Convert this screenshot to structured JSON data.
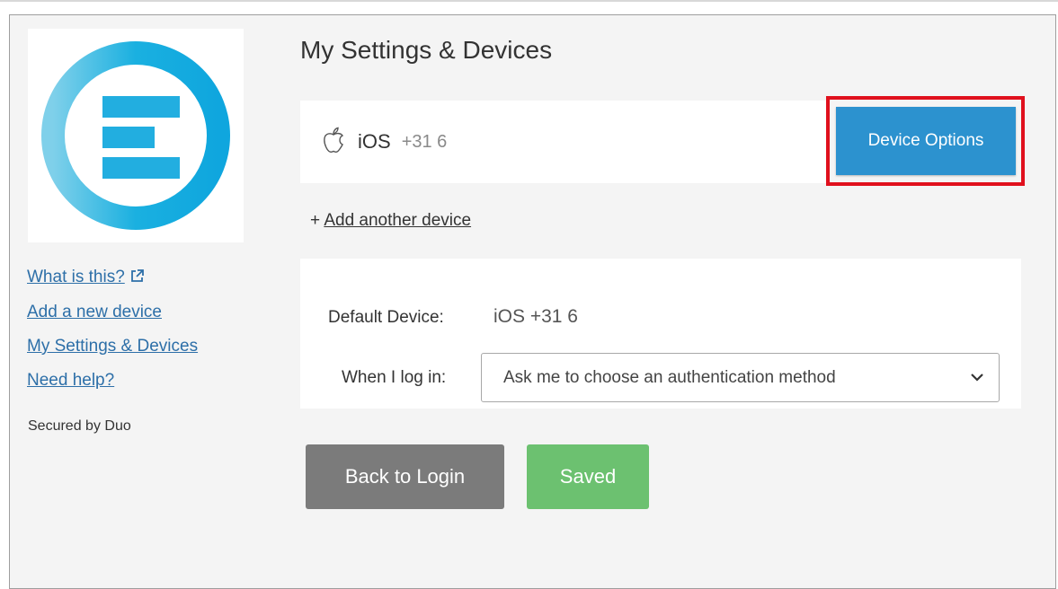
{
  "sidebar": {
    "links": [
      {
        "label": "What is this?",
        "external": true
      },
      {
        "label": "Add a new device"
      },
      {
        "label": "My Settings & Devices"
      },
      {
        "label": "Need help?"
      }
    ],
    "secured_text": "Secured by Duo"
  },
  "main": {
    "title": "My Settings & Devices",
    "device": {
      "icon": "apple-icon",
      "name": "iOS",
      "number": "+31 6",
      "options_label": "Device Options"
    },
    "add_device_prefix": "+ ",
    "add_device_label": "Add another device",
    "default_device_label": "Default Device:",
    "default_device_value": "iOS +31 6",
    "when_login_label": "When I log in:",
    "when_login_value": "Ask me to choose an authentication method",
    "back_label": "Back to Login",
    "saved_label": "Saved"
  },
  "colors": {
    "accent": "#2c92cf",
    "highlight": "#e0101d",
    "saved": "#6cc170",
    "back": "#7b7b7b",
    "link": "#2d6fa8"
  }
}
